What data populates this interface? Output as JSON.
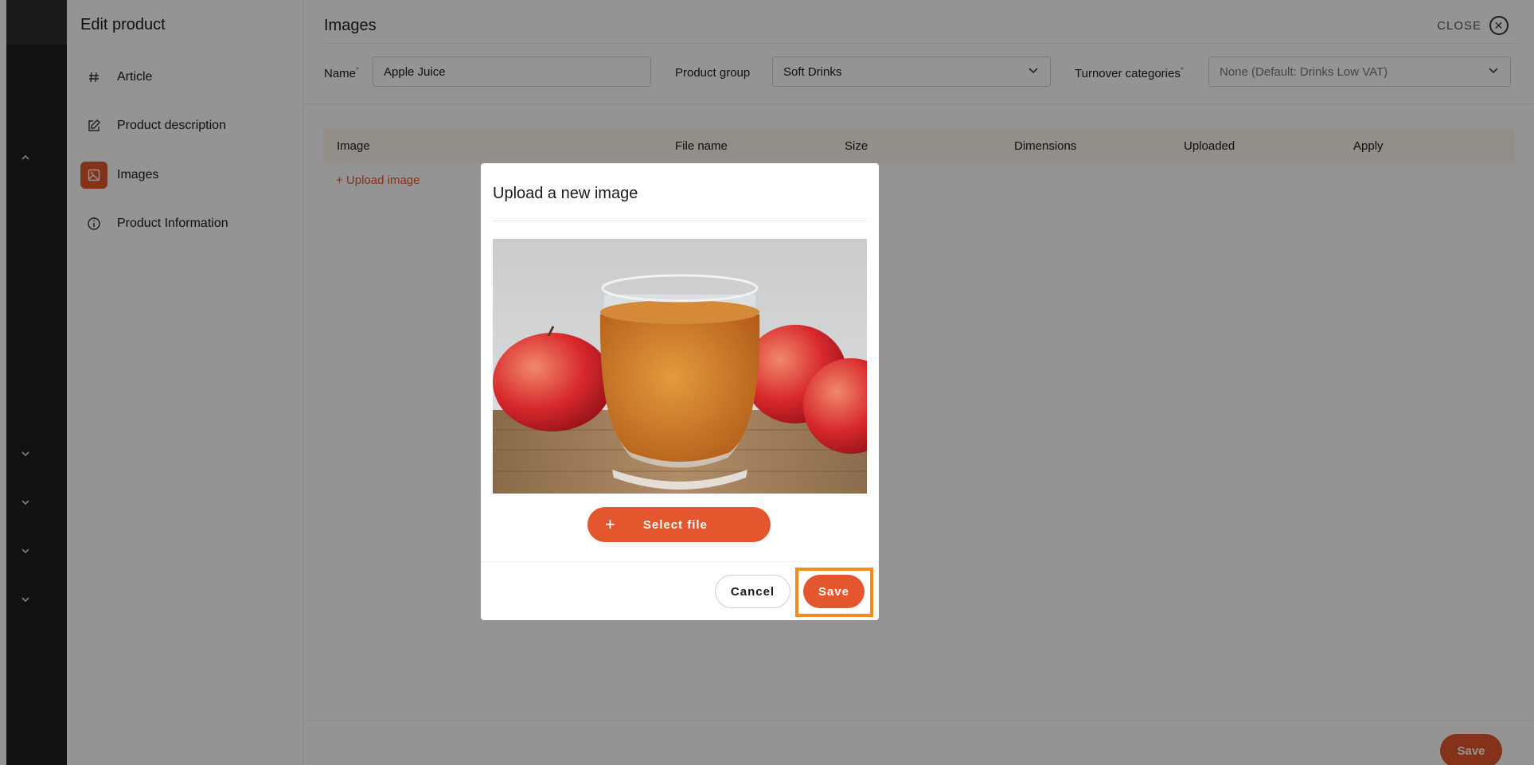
{
  "sidebar": {
    "title": "Edit product",
    "items": [
      {
        "label": "Article",
        "icon": "hash-icon",
        "active": false
      },
      {
        "label": "Product description",
        "icon": "edit-icon",
        "active": false
      },
      {
        "label": "Images",
        "icon": "image-icon",
        "active": true
      },
      {
        "label": "Product Information",
        "icon": "info-icon",
        "active": false
      }
    ]
  },
  "header": {
    "title": "Images",
    "close_label": "CLOSE"
  },
  "form": {
    "name_label": "Name",
    "name_required": "*",
    "name_value": "Apple Juice",
    "group_label": "Product group",
    "group_value": "Soft Drinks",
    "turnover_label": "Turnover categories",
    "turnover_required": "*",
    "turnover_value": "None (Default: Drinks Low VAT)"
  },
  "table": {
    "columns": [
      "Image",
      "File name",
      "Size",
      "Dimensions",
      "Uploaded",
      "Apply"
    ],
    "upload_link": "+ Upload image"
  },
  "footer": {
    "save_label": "Save"
  },
  "modal": {
    "title": "Upload a new image",
    "select_file_label": "Select file",
    "cancel_label": "Cancel",
    "save_label": "Save",
    "preview_icon": "apple-juice-photo"
  },
  "colors": {
    "accent": "#e4572e",
    "highlight": "#f38b1c",
    "table_header": "#fdf4e9"
  }
}
